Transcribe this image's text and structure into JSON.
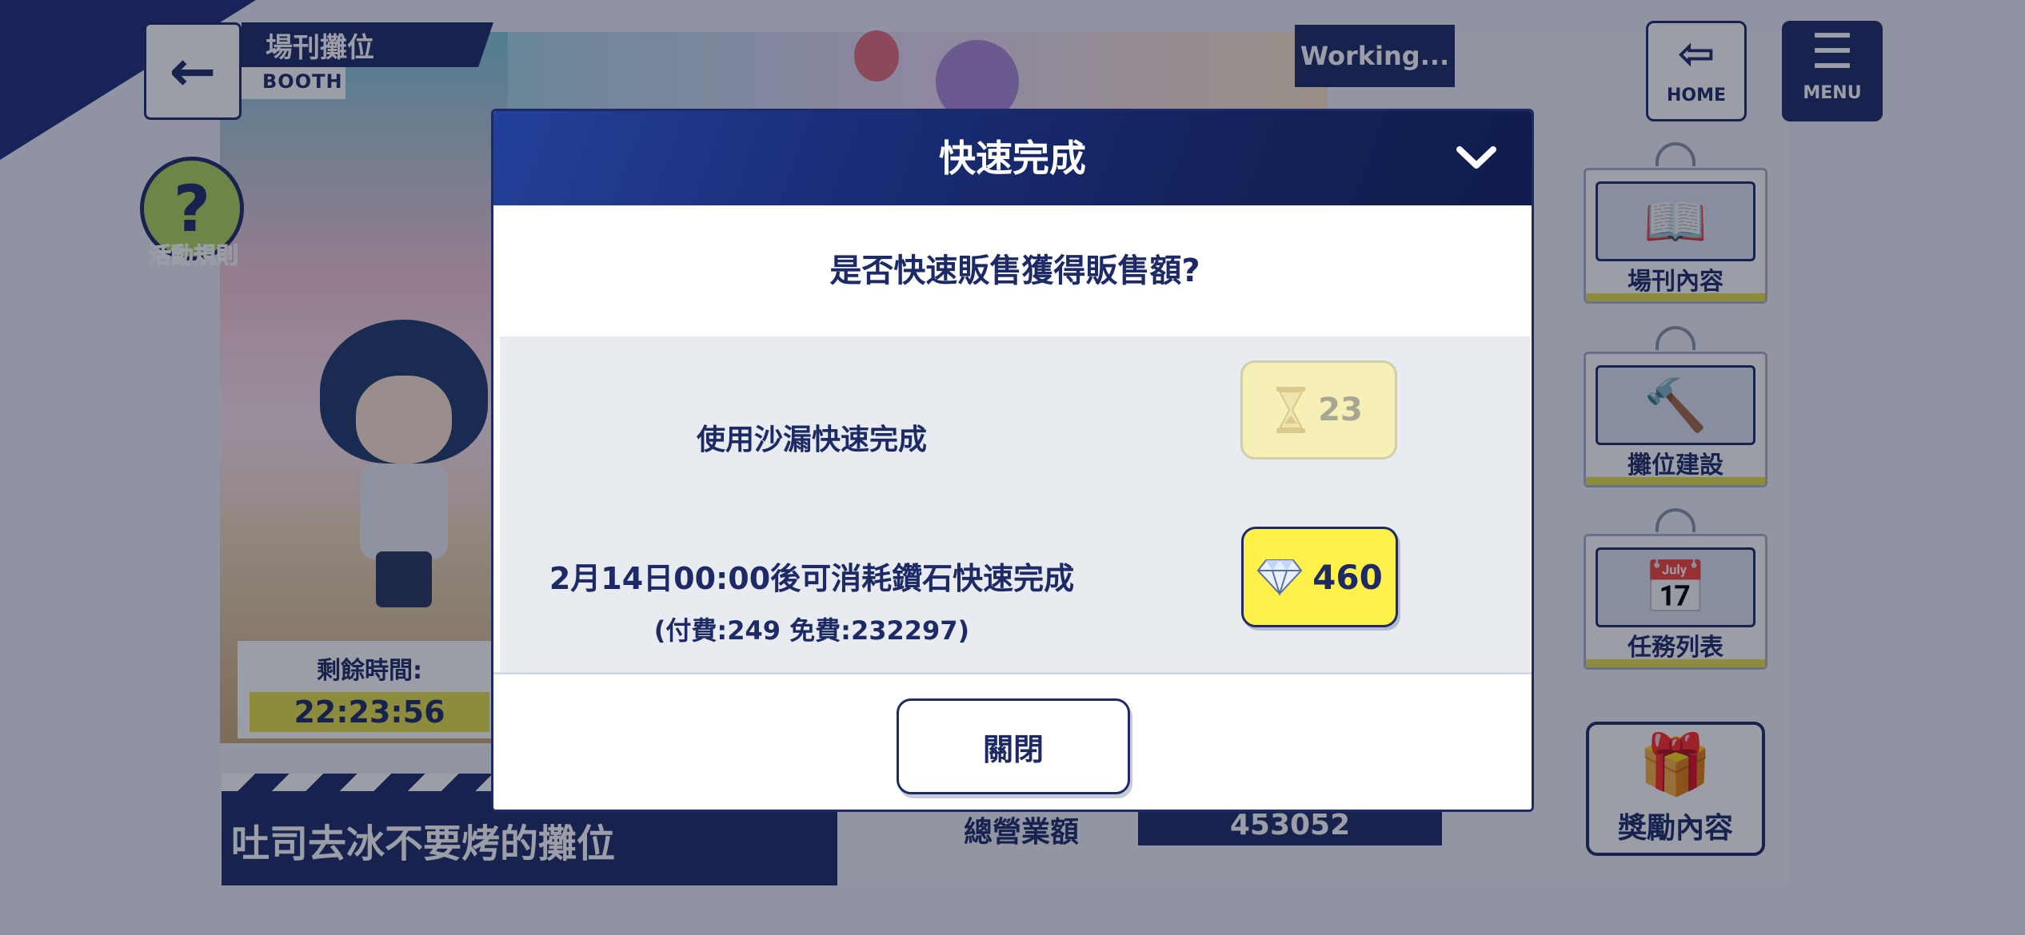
{
  "header": {
    "booth_title": "場刊攤位",
    "booth_subtitle": "BOOTH",
    "working_status": "Working...",
    "home_label": "HOME",
    "menu_label": "MENU",
    "back_icon": "arrow-left-icon",
    "home_icon": "door-exit-icon",
    "menu_icon": "hamburger-icon"
  },
  "rules": {
    "label": "活動規則",
    "icon": "question-mark-icon"
  },
  "timer": {
    "label": "剩餘時間:",
    "value": "22:23:56"
  },
  "booth": {
    "name": "吐司去冰不要烤的攤位"
  },
  "sales": {
    "label": "總營業額",
    "value": "453052"
  },
  "side_menu": {
    "items": [
      {
        "label": "場刊內容",
        "icon": "open-book-icon"
      },
      {
        "label": "攤位建設",
        "icon": "hammer-brush-icon"
      },
      {
        "label": "任務列表",
        "icon": "calendar-icon"
      }
    ],
    "reward_label": "獎勵內容",
    "reward_icon": "gift-icon"
  },
  "modal": {
    "title": "快速完成",
    "question": "是否快速販售獲得販售額?",
    "hourglass_option": {
      "text": "使用沙漏快速完成",
      "count": "23",
      "icon": "hourglass-icon"
    },
    "diamond_option": {
      "text": "2月14日00:00後可消耗鑽石快速完成",
      "detail": "(付費:249 免費:232297)",
      "cost": "460",
      "icon": "diamond-icon"
    },
    "close_label": "關閉",
    "collapse_icon": "chevron-down-icon"
  },
  "colors": {
    "navy": "#1d2a66",
    "accent_yellow": "#fff04a",
    "disabled_yellow": "#f6f0b6",
    "option_bg": "#e8ecf0"
  }
}
